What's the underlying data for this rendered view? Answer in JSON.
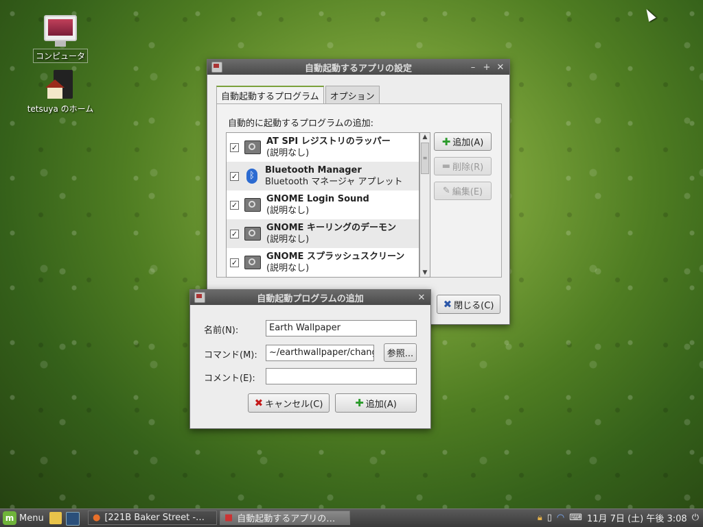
{
  "desktop": {
    "icons": [
      {
        "label": "コンピュータ"
      },
      {
        "label": "tetsuya のホーム"
      }
    ]
  },
  "main_window": {
    "title": "自動起動するアプリの設定",
    "controls": {
      "minimize": "–",
      "maximize": "+",
      "close": "✕"
    },
    "tabs": [
      {
        "label": "自動起動するプログラム"
      },
      {
        "label": "オプション"
      }
    ],
    "section_label": "自動的に起動するプログラムの追加:",
    "programs": [
      {
        "checked": "✓",
        "name": "AT SPI レジストリのラッパー",
        "desc": "(説明なし)",
        "icon": "app-gear-icon"
      },
      {
        "checked": "✓",
        "name": "Bluetooth Manager",
        "desc": "Bluetooth マネージャ アプレット",
        "icon": "bluetooth-icon"
      },
      {
        "checked": "✓",
        "name": "GNOME Login Sound",
        "desc": "(説明なし)",
        "icon": "app-gear-icon"
      },
      {
        "checked": "✓",
        "name": "GNOME キーリングのデーモン",
        "desc": "(説明なし)",
        "icon": "app-gear-icon"
      },
      {
        "checked": "✓",
        "name": "GNOME スプラッシュスクリーン",
        "desc": "(説明なし)",
        "icon": "app-gear-icon"
      }
    ],
    "buttons": {
      "add": "追加(A)",
      "remove": "削除(R)",
      "edit": "編集(E)",
      "close": "閉じる(C)"
    }
  },
  "add_dialog": {
    "title": "自動起動プログラムの追加",
    "close": "✕",
    "name_label": "名前(N):",
    "name_value": "Earth Wallpaper",
    "command_label": "コマンド(M):",
    "command_value": "~/earthwallpaper/chang",
    "browse": "参照...",
    "comment_label": "コメント(E):",
    "comment_value": "",
    "cancel": "キャンセル(C)",
    "add": "追加(A)"
  },
  "panel": {
    "menu_label": "Menu",
    "tasks": [
      {
        "label": "[221B Baker Street -…"
      },
      {
        "label": "自動起動するアプリの…"
      }
    ],
    "clock": "11月 7日 (土) 午後 3:08"
  }
}
